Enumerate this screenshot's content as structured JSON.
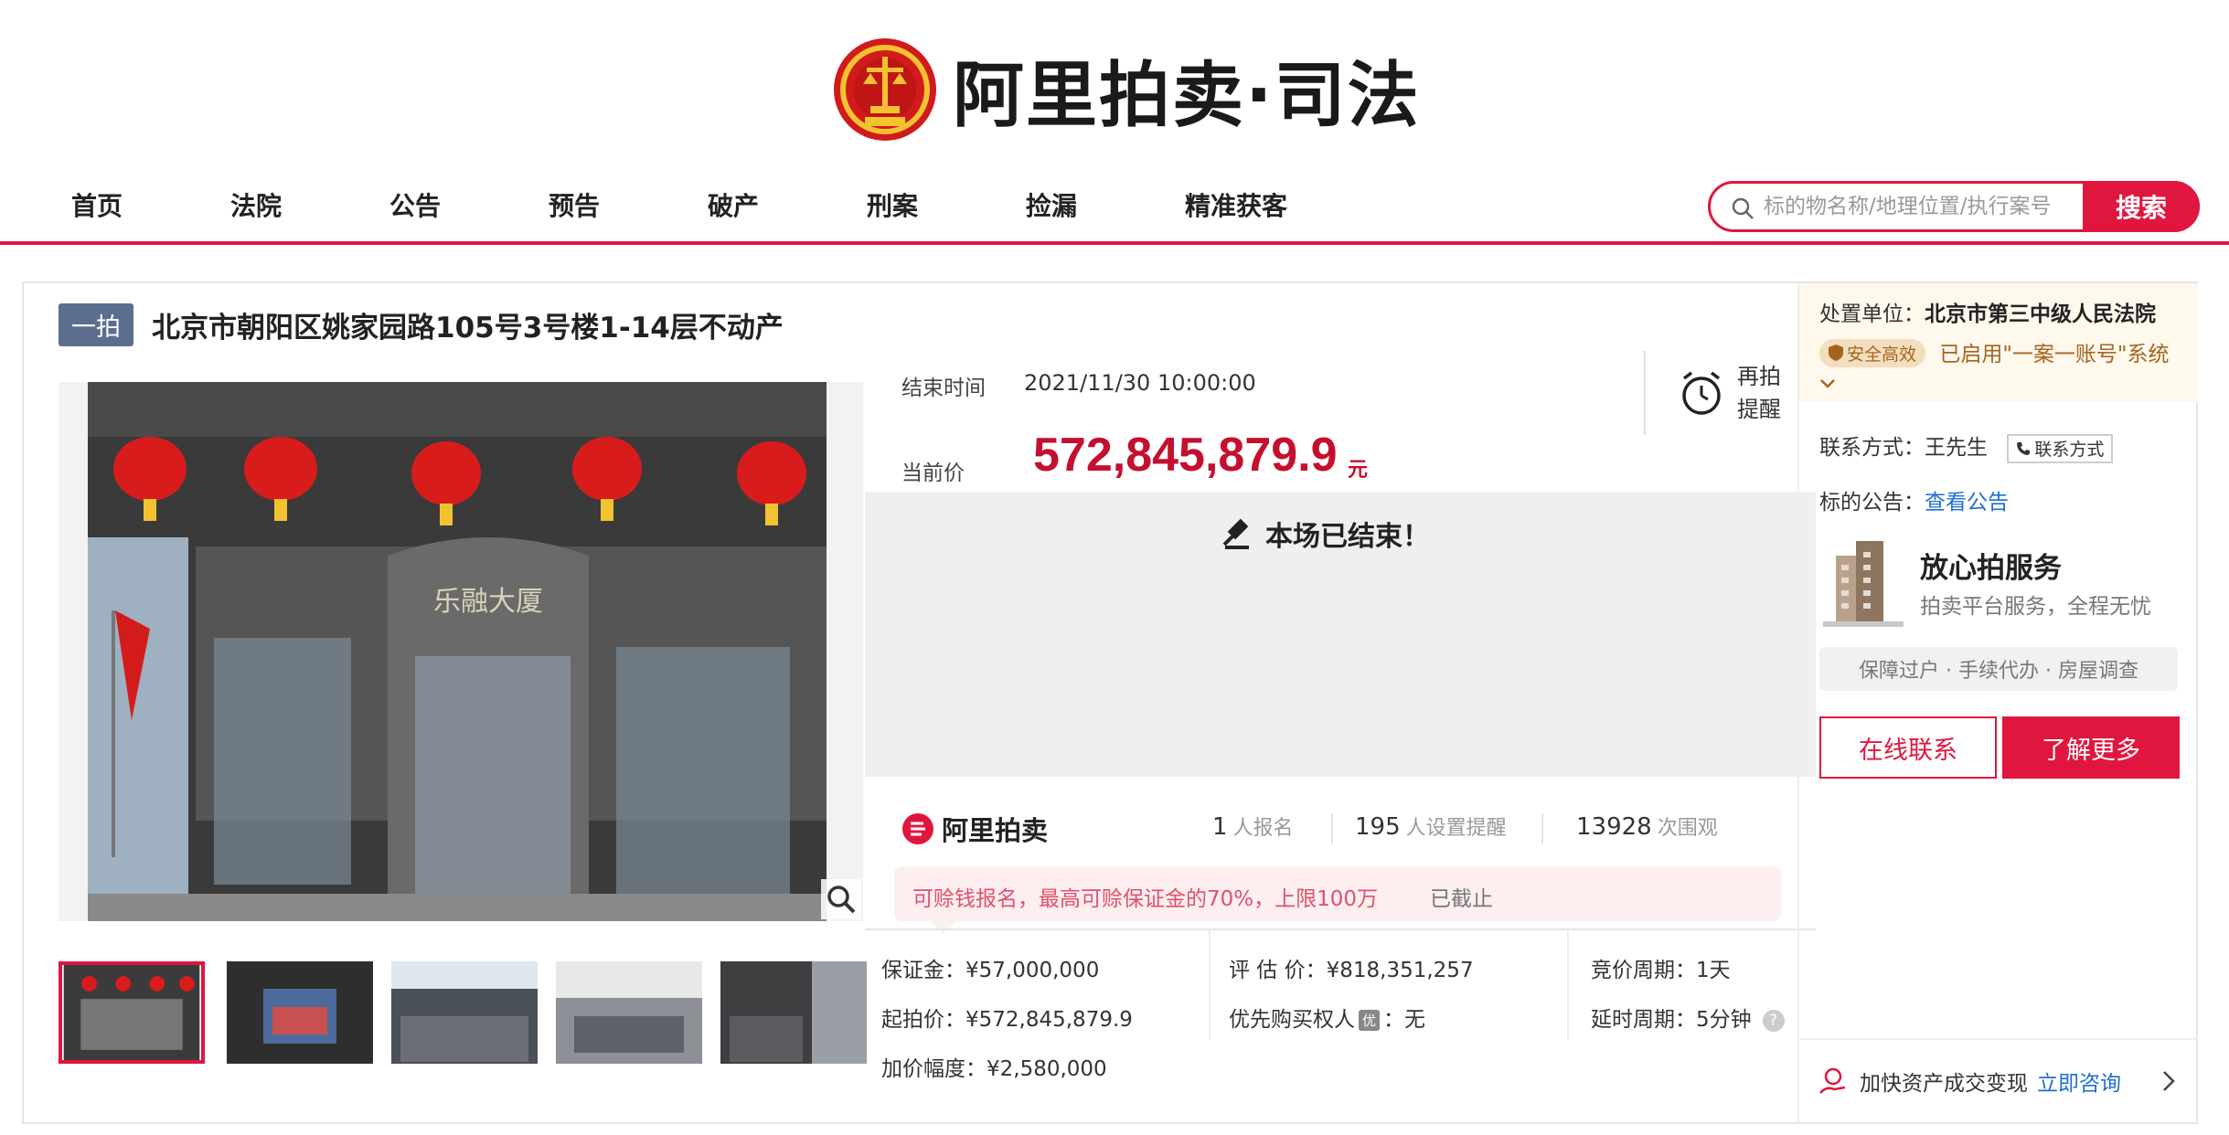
{
  "header": {
    "logo_text": "阿里拍卖·司法"
  },
  "nav": {
    "items": [
      "首页",
      "法院",
      "公告",
      "预告",
      "破产",
      "刑案",
      "捡漏",
      "精准获客"
    ]
  },
  "search": {
    "placeholder": "标的物名称/地理位置/执行案号",
    "button_label": "搜索"
  },
  "item": {
    "round_badge": "一拍",
    "title": "北京市朝阳区姚家园路105号3号楼1-14层不动产",
    "building_sign": "乐融大厦",
    "thumbnail_count": 5,
    "selected_thumbnail": 1
  },
  "auction": {
    "end_time_label": "结束时间",
    "end_time": "2021/11/30 10:00:00",
    "price_label": "当前价",
    "price": "572,845,879.9",
    "price_unit": "元",
    "remind_line1": "再拍",
    "remind_line2": "提醒",
    "ended_text": "本场已结束！"
  },
  "stats": {
    "brand": "阿里拍卖",
    "signup_count": "1",
    "signup_label": "人报名",
    "remind_count": "195",
    "remind_label": "人设置提醒",
    "view_count": "13928",
    "view_label": "次围观"
  },
  "deposit_tip": {
    "text": "可赊钱报名，最高可赊保证金的70%，上限100万",
    "status": "已截止"
  },
  "info": {
    "deposit": "保证金：¥57,000,000",
    "start_price": "起拍价：¥572,845,879.9",
    "increment": "加价幅度：¥2,580,000",
    "appraisal": "评 估 价：¥818,351,257",
    "priority_label": "优先购买权人",
    "priority_tag": "优",
    "priority_value": "：无",
    "bid_cycle": "竞价周期：1天",
    "delay_cycle": "延时周期：5分钟",
    "help": "?"
  },
  "sidebar": {
    "unit_label": "处置单位：",
    "unit_value": "北京市第三中级人民法院",
    "safe_tag": "安全高效",
    "account_text": "已启用\"一案一账号\"系统",
    "contact_label": "联系方式：",
    "contact_name": "王先生",
    "contact_button": "联系方式",
    "notice_label": "标的公告：",
    "notice_link": "查看公告",
    "service_title": "放心拍服务",
    "service_sub": "拍卖平台服务，全程无忧",
    "service_pill": "保障过户 · 手续代办 · 房屋调查",
    "btn_online": "在线联系",
    "btn_more": "了解更多",
    "bottom_text": "加快资产成交变现",
    "bottom_link": "立即咨询"
  },
  "colors": {
    "brand_red": "#e0163f",
    "price_red": "#c4102e",
    "link_blue": "#1e6ed2"
  }
}
